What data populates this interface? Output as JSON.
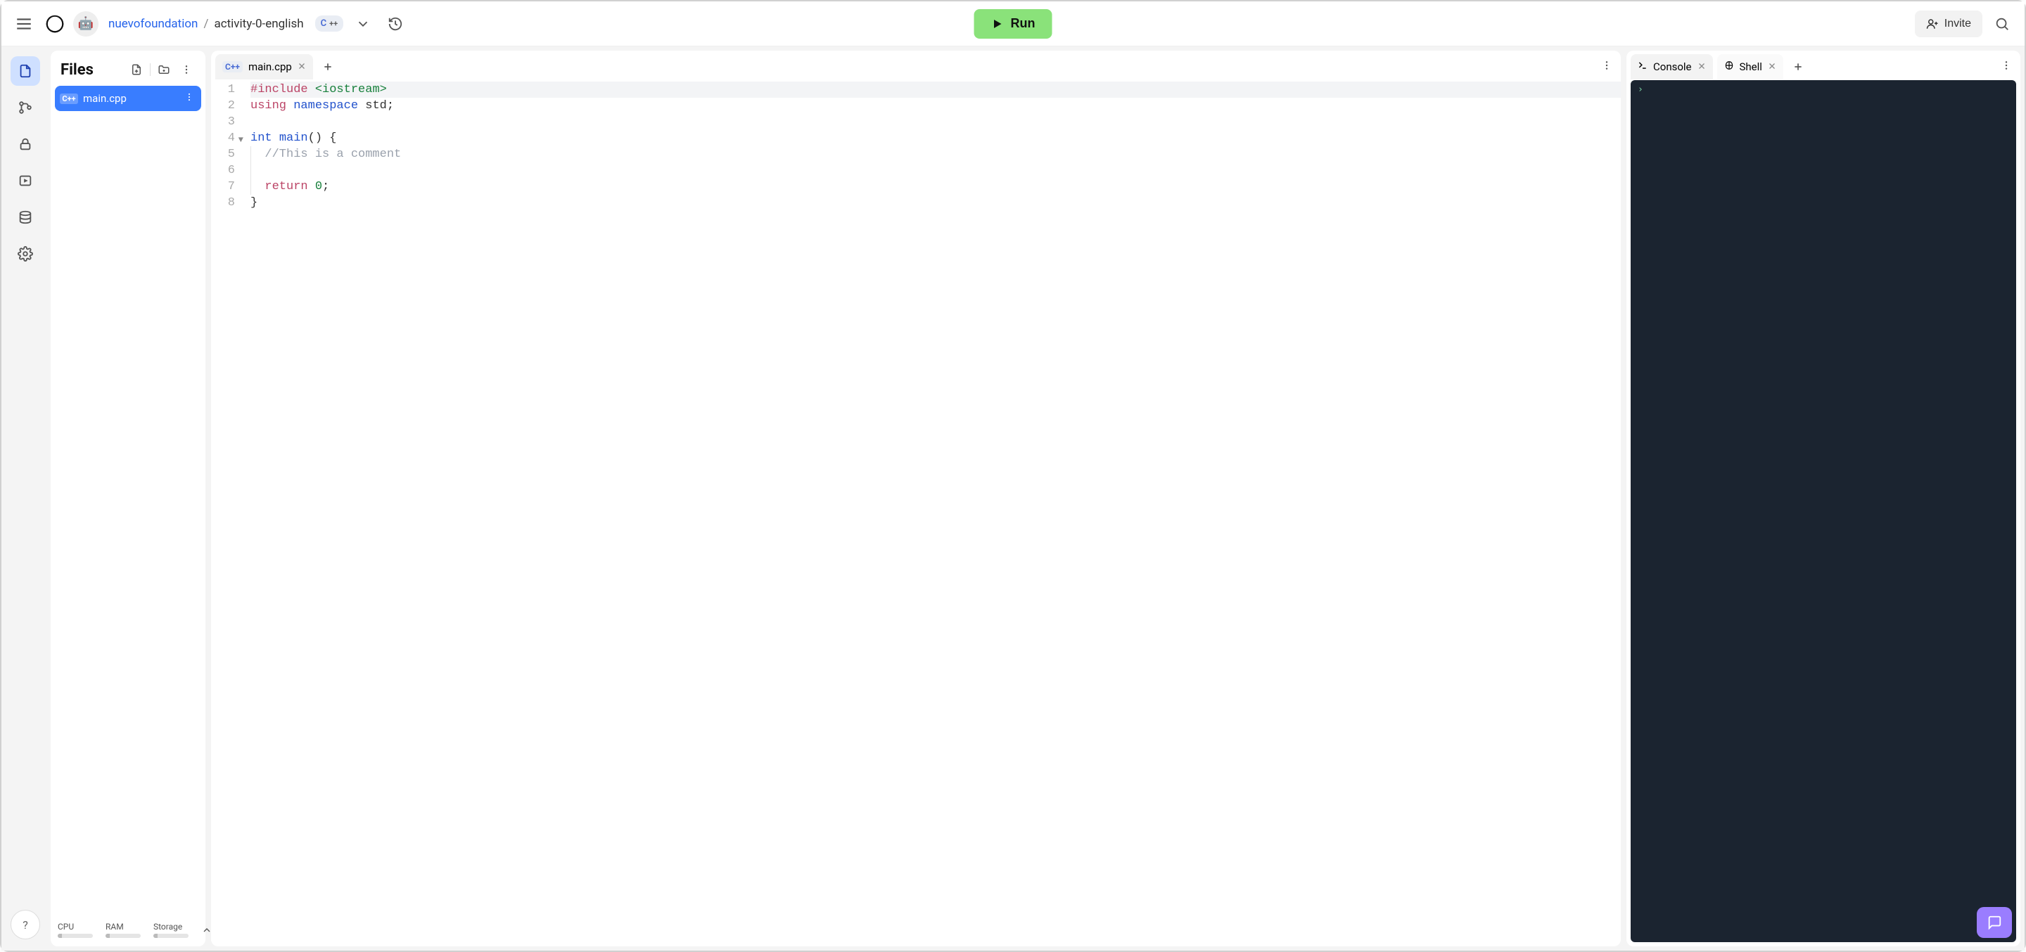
{
  "header": {
    "owner": "nuevofoundation",
    "repo": "activity-0-english",
    "lang_badge": "C++",
    "run_label": "Run",
    "invite_label": "Invite"
  },
  "sidebar": {
    "rail": [
      {
        "name": "files",
        "active": true
      },
      {
        "name": "version-control",
        "active": false
      },
      {
        "name": "secrets",
        "active": false
      },
      {
        "name": "debugger",
        "active": false
      },
      {
        "name": "database",
        "active": false
      },
      {
        "name": "settings",
        "active": false
      }
    ]
  },
  "files": {
    "title": "Files",
    "items": [
      {
        "name": "main.cpp",
        "icon": "cpp"
      }
    ],
    "stats": {
      "cpu": {
        "label": "CPU"
      },
      "ram": {
        "label": "RAM"
      },
      "storage": {
        "label": "Storage"
      }
    }
  },
  "editor": {
    "tabs": [
      {
        "label": "main.cpp",
        "icon": "cpp"
      }
    ],
    "code": {
      "lines": [
        {
          "n": 1,
          "hl": true,
          "tokens": [
            [
              "k-pre",
              "#include"
            ],
            [
              "",
              " "
            ],
            [
              "k-str",
              "<iostream>"
            ]
          ]
        },
        {
          "n": 2,
          "tokens": [
            [
              "k-pre",
              "using"
            ],
            [
              "",
              " "
            ],
            [
              "k-kw",
              "namespace"
            ],
            [
              "",
              " std;"
            ]
          ]
        },
        {
          "n": 3,
          "tokens": []
        },
        {
          "n": 4,
          "fold": true,
          "tokens": [
            [
              "k-kw",
              "int"
            ],
            [
              "",
              " "
            ],
            [
              "k-kw",
              "main"
            ],
            [
              "",
              "() {"
            ]
          ]
        },
        {
          "n": 5,
          "indent": 1,
          "tokens": [
            [
              "k-com",
              "//This is a comment"
            ]
          ]
        },
        {
          "n": 6,
          "indent": 1,
          "tokens": []
        },
        {
          "n": 7,
          "indent": 1,
          "tokens": [
            [
              "k-pre",
              "return"
            ],
            [
              "",
              " "
            ],
            [
              "k-num",
              "0"
            ],
            [
              "",
              ";"
            ]
          ]
        },
        {
          "n": 8,
          "tokens": [
            [
              "",
              "}"
            ]
          ]
        }
      ]
    }
  },
  "console": {
    "tabs": [
      {
        "label": "Console",
        "icon": "terminal"
      },
      {
        "label": "Shell",
        "icon": "shell"
      }
    ],
    "prompt": "›"
  }
}
